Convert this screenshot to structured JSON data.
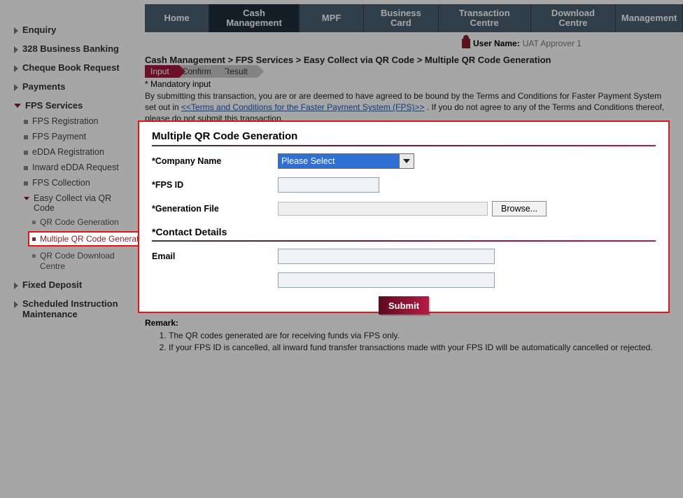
{
  "topnav": [
    {
      "label": "Home"
    },
    {
      "label": "Cash Management",
      "active": true
    },
    {
      "label": "MPF"
    },
    {
      "label": "Business Card"
    },
    {
      "label": "Transaction Centre"
    },
    {
      "label": "Download Centre"
    },
    {
      "label": "Management"
    }
  ],
  "user": {
    "label": "User Name:",
    "value": "UAT Approver 1"
  },
  "breadcrumb": "Cash Management > FPS Services > Easy Collect via QR Code > Multiple QR Code Generation",
  "steps": [
    "Input",
    "Confirm",
    "Result"
  ],
  "mandatory_note": "* Mandatory input",
  "intro": {
    "pre": "By submitting this transaction, you are or are deemed to have agreed to be bound by the Terms and Conditions for Faster Payment System set out in ",
    "link": "<<Terms and Conditions for the Faster Payment System (FPS)>>",
    "post": " . If you do not agree to any of the Terms and Conditions thereof, please do not submit this transaction."
  },
  "sidebar": {
    "top": [
      {
        "label": "Enquiry"
      },
      {
        "label": "328 Business Banking"
      },
      {
        "label": "Cheque Book Request"
      },
      {
        "label": "Payments"
      }
    ],
    "fps_label": "FPS Services",
    "fps_items": [
      {
        "label": "FPS Registration"
      },
      {
        "label": "FPS Payment"
      },
      {
        "label": "eDDA Registration"
      },
      {
        "label": "Inward eDDA Request"
      },
      {
        "label": "FPS Collection"
      }
    ],
    "easy_label": "Easy Collect via QR Code",
    "easy_items": [
      {
        "label": "QR Code Generation"
      },
      {
        "label": "Multiple QR Code Generation",
        "selected": true
      },
      {
        "label": "QR Code Download Centre"
      }
    ],
    "bottom": [
      {
        "label": "Fixed Deposit"
      },
      {
        "label": "Scheduled Instruction Maintenance"
      }
    ]
  },
  "panel": {
    "section1_title": "Multiple QR Code Generation",
    "company_label": "*Company Name",
    "company_value": "Please Select",
    "fpsid_label": "*FPS ID",
    "file_label": "*Generation File",
    "browse_label": "Browse...",
    "section2_title": "*Contact Details",
    "email_label": "Email",
    "submit_label": "Submit"
  },
  "remark": {
    "heading": "Remark:",
    "items": [
      "The QR codes generated are for receiving funds via FPS only.",
      "If your FPS ID is cancelled, all inward fund transfer transactions made with your FPS ID will be automatically cancelled or rejected."
    ]
  }
}
